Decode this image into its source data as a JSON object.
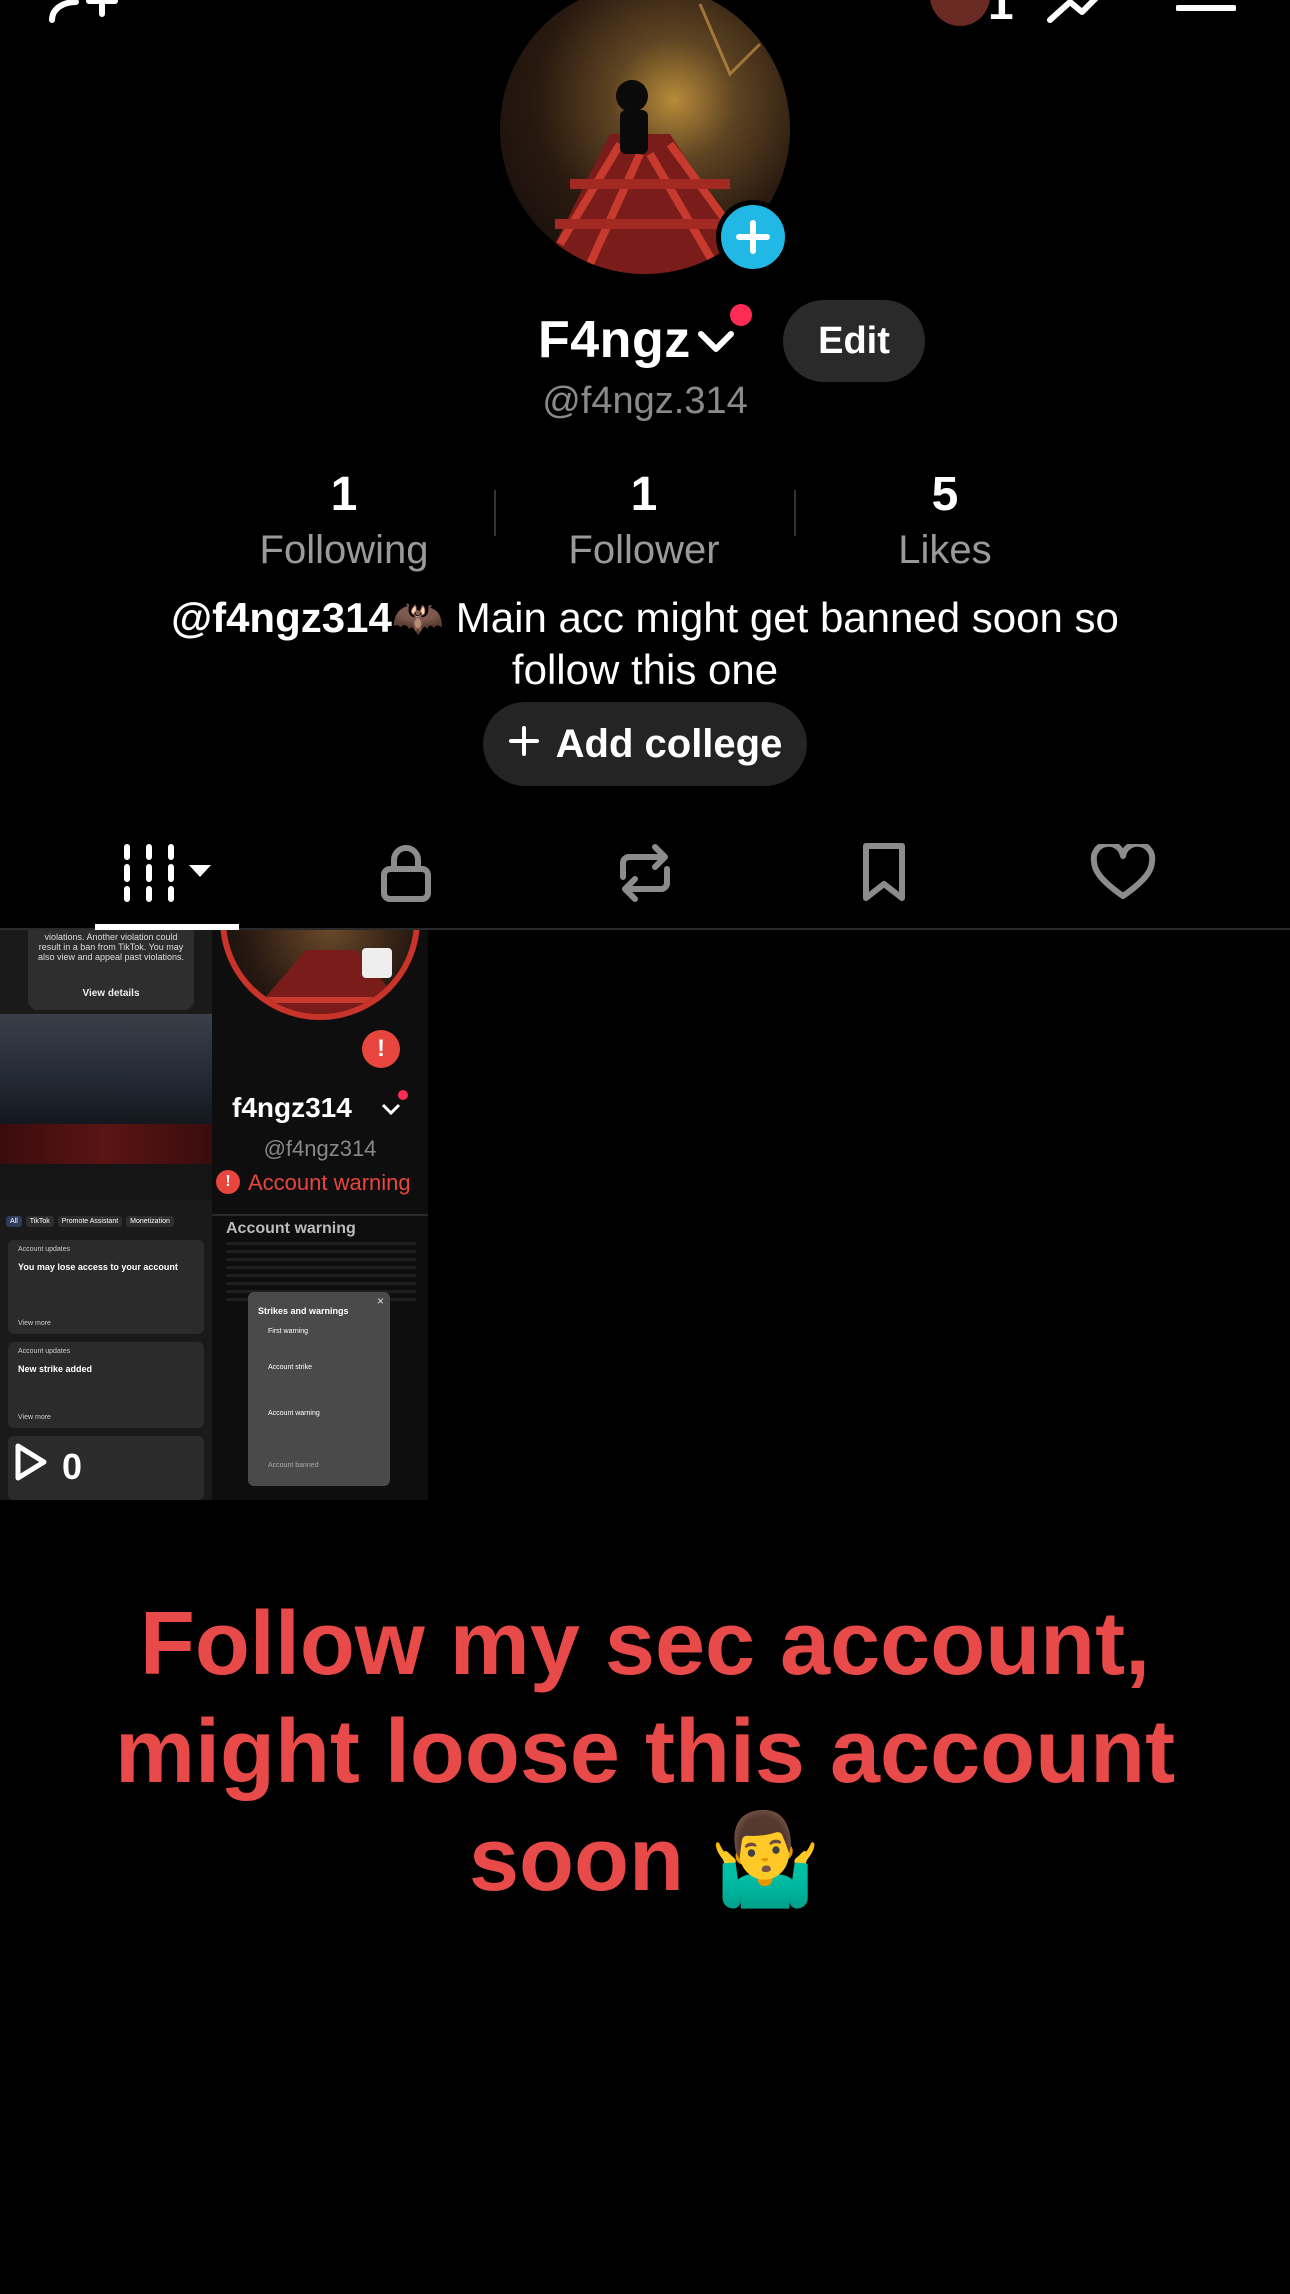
{
  "profile": {
    "display_name": "F4ngz",
    "handle": "@f4ngz.314",
    "edit_label": "Edit",
    "notification_count": "1"
  },
  "stats": [
    {
      "value": "1",
      "label": "Following"
    },
    {
      "value": "1",
      "label": "Follower"
    },
    {
      "value": "5",
      "label": "Likes"
    }
  ],
  "bio": {
    "mention": "@f4ngz314",
    "emoji": "🦇",
    "text_line1": "Main acc might get banned soon so",
    "text_line2": "follow this one"
  },
  "college_button": {
    "icon": "plus-icon",
    "label": "Add college"
  },
  "tabs": [
    {
      "name": "videos",
      "icon": "grid-icon",
      "active": true
    },
    {
      "name": "private",
      "icon": "lock-icon"
    },
    {
      "name": "reposts",
      "icon": "repost-icon"
    },
    {
      "name": "favorites",
      "icon": "bookmark-icon"
    },
    {
      "name": "liked",
      "icon": "heart-icon"
    }
  ],
  "video": {
    "views": "0",
    "overlay": {
      "username": "f4ngz314",
      "handle": "@f4ngz314",
      "warning": "Account warning",
      "section_title": "Account warning",
      "popup_title": "Strikes and warnings",
      "popup_items": [
        "First warning",
        "Account strike",
        "Account warning",
        "Account banned"
      ],
      "chips": [
        "All",
        "TikTok",
        "Promote Assistant",
        "Monetization"
      ],
      "card1_tag": "Account updates",
      "card1_title": "You may lose access to your account",
      "card2_tag": "Account updates",
      "card2_title": "New strike added",
      "view_more": "View more",
      "view_details": "View details",
      "top_text": "violations. Another violation could result in a ban from TikTok. You may also view and appeal past violations."
    }
  },
  "promo": {
    "line1": "Follow my sec account,",
    "line2": "might loose this account",
    "line3": "soon 🤷‍♂️"
  },
  "colors": {
    "background": "#000000",
    "accent_blue": "#22b8e6",
    "accent_red": "#fe2c55",
    "promo_red": "#e84a4a",
    "muted": "#9a9a9a"
  }
}
